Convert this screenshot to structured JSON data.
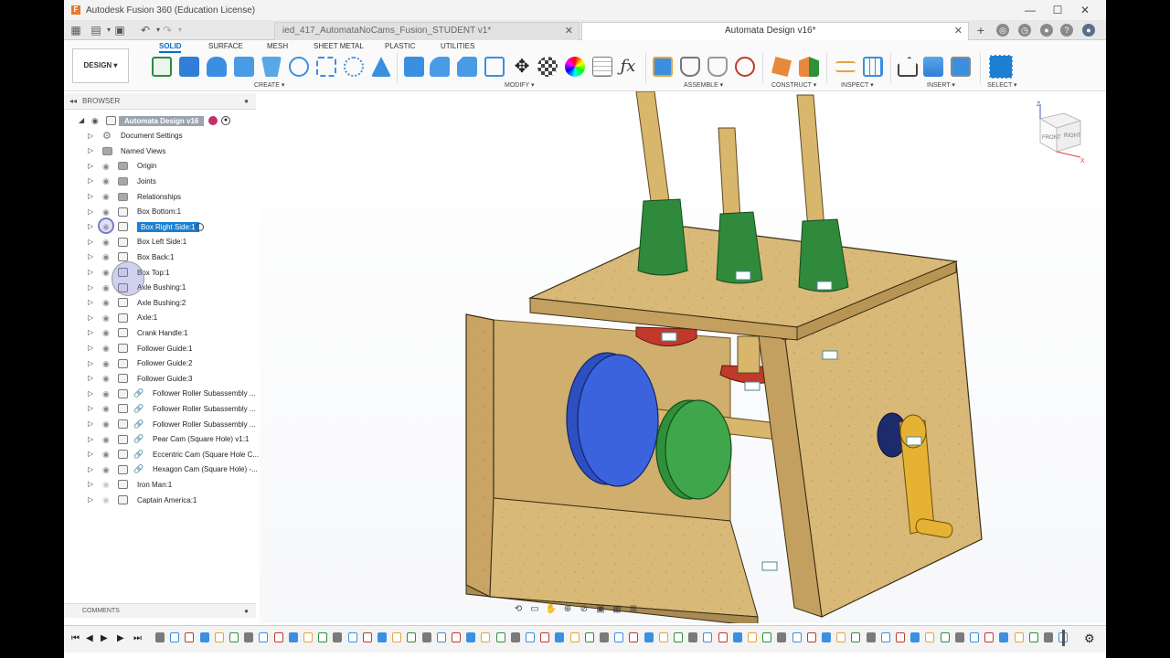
{
  "window": {
    "title": "Autodesk Fusion 360 (Education License)",
    "controls": [
      "—",
      "☐",
      "✕"
    ]
  },
  "tabs": [
    {
      "label": "ied_417_AutomataNoCams_Fusion_STUDENT v1*",
      "close": "✕"
    },
    {
      "label": "Automata Design v16*",
      "close": "✕"
    }
  ],
  "toolbar": {
    "workspace_tabs": [
      "SOLID",
      "SURFACE",
      "MESH",
      "SHEET METAL",
      "PLASTIC",
      "UTILITIES"
    ],
    "design_button": "DESIGN ▾",
    "groups": [
      "CREATE ▾",
      "MODIFY ▾",
      "ASSEMBLE ▾",
      "CONSTRUCT ▾",
      "INSPECT ▾",
      "INSERT ▾",
      "SELECT ▾"
    ],
    "formula_icon": "ƒx"
  },
  "browser": {
    "header": "BROWSER",
    "root": "Automata Design v16",
    "items": [
      {
        "label": "Document Settings",
        "icon": "gear-icon",
        "eye": false
      },
      {
        "label": "Named Views",
        "icon": "folder-icon",
        "eye": false
      },
      {
        "label": "Origin",
        "icon": "folder-icon",
        "eye": true
      },
      {
        "label": "Joints",
        "icon": "folder-icon",
        "eye": true
      },
      {
        "label": "Relationships",
        "icon": "folder-icon",
        "eye": true
      },
      {
        "label": "Box Bottom:1",
        "icon": "component-icon",
        "eye": true
      },
      {
        "label": "Box Right Side:1",
        "icon": "component-icon",
        "eye": true,
        "selected": true
      },
      {
        "label": "Box Left Side:1",
        "icon": "component-icon",
        "eye": true
      },
      {
        "label": "Box Back:1",
        "icon": "component-icon",
        "eye": true
      },
      {
        "label": "Box Top:1",
        "icon": "component-icon",
        "eye": true
      },
      {
        "label": "Axle Bushing:1",
        "icon": "component-icon",
        "eye": true
      },
      {
        "label": "Axle Bushing:2",
        "icon": "component-icon",
        "eye": true
      },
      {
        "label": "Axle:1",
        "icon": "component-icon",
        "eye": true
      },
      {
        "label": "Crank Handle:1",
        "icon": "component-icon",
        "eye": true
      },
      {
        "label": "Follower Guide:1",
        "icon": "component-icon",
        "eye": true
      },
      {
        "label": "Follower Guide:2",
        "icon": "component-icon",
        "eye": true
      },
      {
        "label": "Follower Guide:3",
        "icon": "component-icon",
        "eye": true
      },
      {
        "label": "Follower Roller Subassembly ...",
        "icon": "linked-component-icon",
        "eye": true
      },
      {
        "label": "Follower Roller Subassembly ...",
        "icon": "linked-component-icon",
        "eye": true
      },
      {
        "label": "Follower Roller Subassembly ...",
        "icon": "linked-component-icon",
        "eye": true
      },
      {
        "label": "Pear Cam (Square Hole) v1:1",
        "icon": "linked-component-icon",
        "eye": true
      },
      {
        "label": "Eccentric Cam (Square Hole C...",
        "icon": "linked-component-icon",
        "eye": true
      },
      {
        "label": "Hexagon Cam (Square Hole) -...",
        "icon": "linked-component-icon",
        "eye": true
      },
      {
        "label": "Iron Man:1",
        "icon": "component-icon",
        "eye": false
      },
      {
        "label": "Captain America:1",
        "icon": "component-icon",
        "eye": false
      }
    ]
  },
  "comments": {
    "label": "COMMENTS"
  },
  "viewcube": {
    "front": "FRONT",
    "right": "RIGHT",
    "z": "Z",
    "x": "X"
  },
  "colors": {
    "accent": "#0a6fc2",
    "selected": "#1c7fd1",
    "wood": "#d9b978",
    "cam_blue": "#2d4fc0",
    "cam_green": "#2f8f3a",
    "follower_green": "#2f8a3c",
    "crank_yellow": "#e6b233",
    "roller_red": "#c0392b"
  }
}
